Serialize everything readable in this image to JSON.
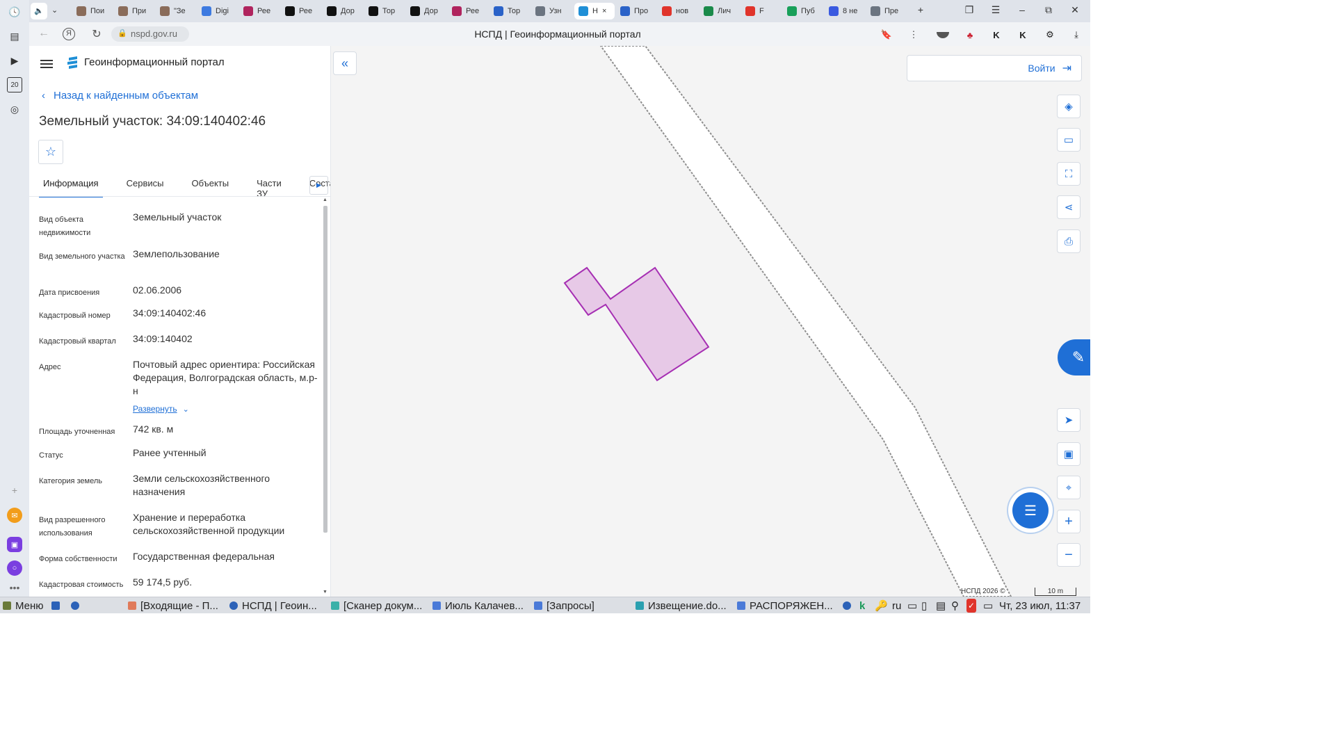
{
  "browser": {
    "tabs": [
      {
        "label": "Пои",
        "color": "#8a6c5a"
      },
      {
        "label": "При",
        "color": "#8a6c5a"
      },
      {
        "label": "\"Зе",
        "color": "#8a6c5a"
      },
      {
        "label": "Digi",
        "color": "#3d7ae0"
      },
      {
        "label": "Рее",
        "color": "#b0245e"
      },
      {
        "label": "Рее",
        "color": "#111111"
      },
      {
        "label": "Дор",
        "color": "#111111"
      },
      {
        "label": "Тор",
        "color": "#111111"
      },
      {
        "label": "Дор",
        "color": "#111111"
      },
      {
        "label": "Рее",
        "color": "#b0245e"
      },
      {
        "label": "Тор",
        "color": "#2a62c8"
      },
      {
        "label": "Узн",
        "color": "#6b7480"
      },
      {
        "label": "Н",
        "color": "#1f8fd6"
      },
      {
        "label": "Про",
        "color": "#2a62c8"
      },
      {
        "label": "нов",
        "color": "#e0342b"
      },
      {
        "label": "Лич",
        "color": "#1a8a4a"
      },
      {
        "label": "F",
        "color": "#e0342b"
      },
      {
        "label": "Пуб",
        "color": "#19a05a"
      },
      {
        "label": "8 не",
        "color": "#3a5ae0"
      },
      {
        "label": "Пре",
        "color": "#6b7480"
      }
    ],
    "active_tab_close": "×",
    "new_tab": "+",
    "url": "nspd.gov.ru",
    "page_title": "НСПД | Геоинформационный портал"
  },
  "panel": {
    "portal_name": "Геоинформационный портал",
    "back_link": "Назад к найденным объектам",
    "object_title": "Земельный участок: 34:09:140402:46",
    "tabs": [
      "Информация",
      "Сервисы",
      "Объекты",
      "Части ЗУ",
      "Состав"
    ],
    "info": [
      {
        "key": "Вид объекта недвижимости",
        "value": "Земельный участок"
      },
      {
        "key": "Вид земельного участка",
        "value": "Землепользование"
      },
      {
        "key": "Дата присвоения",
        "value": "02.06.2006"
      },
      {
        "key": "Кадастровый номер",
        "value": "34:09:140402:46"
      },
      {
        "key": "Кадастровый квартал",
        "value": "34:09:140402"
      },
      {
        "key": "Адрес",
        "value": "Почтовый адрес ориентира: Российская Федерация, Волгоградская область, м.р-н"
      },
      {
        "key": "Площадь уточненная",
        "value": "742 кв. м"
      },
      {
        "key": "Статус",
        "value": "Ранее учтенный"
      },
      {
        "key": "Категория земель",
        "value": "Земли сельскохозяйственного назначения"
      },
      {
        "key": "Вид разрешенного использования",
        "value": "Хранение и переработка сельскохозяйственной продукции"
      },
      {
        "key": "Форма собственности",
        "value": "Государственная федеральная"
      },
      {
        "key": "Кадастровая стоимость",
        "value": "59 174,5 руб."
      }
    ],
    "expand_label": "Развернуть"
  },
  "map": {
    "login_label": "Войти",
    "copyright": "НСПД 2026 ©",
    "scale_label": "10 m",
    "parcel_fill": "#e7c9e7",
    "parcel_stroke": "#a62fb3"
  },
  "taskbar": {
    "menu_label": "Меню",
    "items": [
      "[Входящие - П...",
      "НСПД | Геоин...",
      "[Сканер докум...",
      "Июль Калачев...",
      "[Запросы]",
      "Извещение.do...",
      "РАСПОРЯЖЕН..."
    ],
    "lang": "ru",
    "clock": "Чт, 23 июл, 11:37"
  },
  "sidebar": {
    "badge": "20"
  }
}
